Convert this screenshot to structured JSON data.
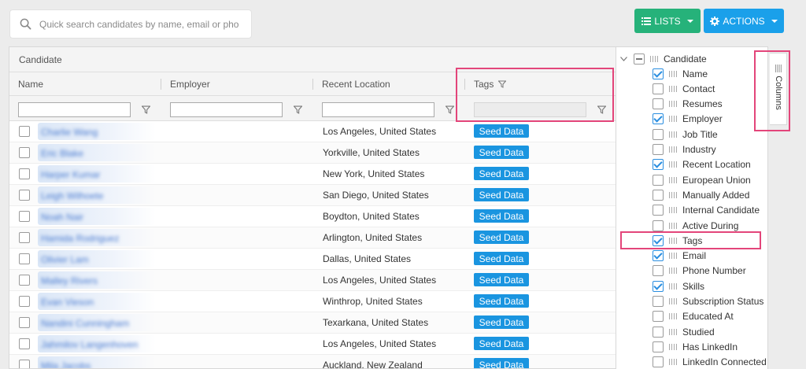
{
  "search": {
    "placeholder": "Quick search candidates by name, email or pho"
  },
  "toolbar": {
    "lists_label": "LISTS",
    "actions_label": "ACTIONS"
  },
  "grid": {
    "group_header": "Candidate",
    "columns": [
      "Name",
      "Employer",
      "Recent Location",
      "Tags"
    ],
    "rows": [
      {
        "name": "Charlie Wang",
        "location": "Los Angeles, United States",
        "tag": "Seed Data"
      },
      {
        "name": "Eric Blake",
        "location": "Yorkville, United States",
        "tag": "Seed Data"
      },
      {
        "name": "Harper Kumar",
        "location": "New York, United States",
        "tag": "Seed Data"
      },
      {
        "name": "Leigh Wilhoete",
        "location": "San Diego, United States",
        "tag": "Seed Data"
      },
      {
        "name": "Noah Nair",
        "location": "Boydton, United States",
        "tag": "Seed Data"
      },
      {
        "name": "Hamida Rodriguez",
        "location": "Arlington, United States",
        "tag": "Seed Data"
      },
      {
        "name": "Olivier Lam",
        "location": "Dallas, United States",
        "tag": "Seed Data"
      },
      {
        "name": "Malley Rivers",
        "location": "Los Angeles, United States",
        "tag": "Seed Data"
      },
      {
        "name": "Evan Vieson",
        "location": "Winthrop, United States",
        "tag": "Seed Data"
      },
      {
        "name": "Nandini Cunningham",
        "location": "Texarkana, United States",
        "tag": "Seed Data"
      },
      {
        "name": "Jahmilov Langenhoven",
        "location": "Los Angeles, United States",
        "tag": "Seed Data"
      },
      {
        "name": "Mila Jacobs",
        "location": "Auckland, New Zealand",
        "tag": "Seed Data"
      }
    ]
  },
  "columns_panel": {
    "tab_label": "Columns",
    "root_label": "Candidate",
    "items": [
      {
        "label": "Name",
        "checked": true
      },
      {
        "label": "Contact",
        "checked": false
      },
      {
        "label": "Resumes",
        "checked": false
      },
      {
        "label": "Employer",
        "checked": true
      },
      {
        "label": "Job Title",
        "checked": false
      },
      {
        "label": "Industry",
        "checked": false
      },
      {
        "label": "Recent Location",
        "checked": true
      },
      {
        "label": "European Union",
        "checked": false
      },
      {
        "label": "Manually Added",
        "checked": false
      },
      {
        "label": "Internal Candidate",
        "checked": false
      },
      {
        "label": "Active During",
        "checked": false
      },
      {
        "label": "Tags",
        "checked": true
      },
      {
        "label": "Email",
        "checked": true
      },
      {
        "label": "Phone Number",
        "checked": false
      },
      {
        "label": "Skills",
        "checked": true
      },
      {
        "label": "Subscription Status",
        "checked": false
      },
      {
        "label": "Educated At",
        "checked": false
      },
      {
        "label": "Studied",
        "checked": false
      },
      {
        "label": "Has LinkedIn",
        "checked": false
      },
      {
        "label": "LinkedIn Connected",
        "checked": false
      }
    ]
  },
  "colors": {
    "lists_green": "#26b27a",
    "actions_blue": "#1aa0ea",
    "tag_blue": "#1a95e0",
    "highlight_pink": "#e3457a"
  }
}
